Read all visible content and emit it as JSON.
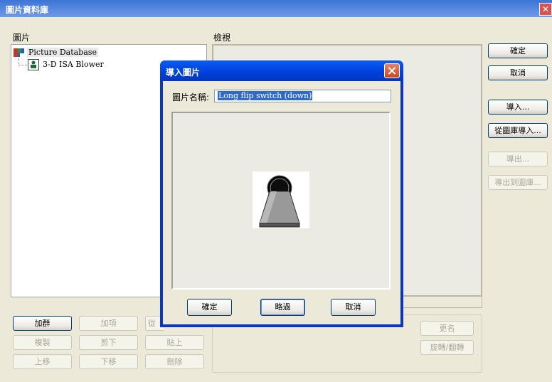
{
  "main_window": {
    "title": "圖片資料庫",
    "pictures_label": "圖片",
    "view_label": "檢視",
    "tree": {
      "root_label": "Picture Database",
      "child_label": "3-D ISA Blower"
    },
    "right_buttons": {
      "ok": "確定",
      "cancel": "取消",
      "import": "導入...",
      "import_from_library": "從圖庫導入...",
      "export": "導出...",
      "export_to_library": "導出到圖庫..."
    },
    "bottom_buttons": {
      "add_group": "加群",
      "add_item": "加項",
      "from_partial": "從",
      "copy": "複製",
      "cut": "剪下",
      "paste": "貼上",
      "move_up": "上移",
      "move_down": "下移",
      "delete": "刪除",
      "rename": "更名",
      "rotate_flip": "旋轉/翻轉"
    }
  },
  "import_dialog": {
    "title": "導入圖片",
    "name_label": "圖片名稱:",
    "name_value": "Long flip switch (down)",
    "ok": "確定",
    "skip": "略過",
    "cancel": "取消"
  },
  "colors": {
    "titlebar_blue": "#0a36c5",
    "selection": "#316ac5",
    "close_red": "#d9534f"
  }
}
